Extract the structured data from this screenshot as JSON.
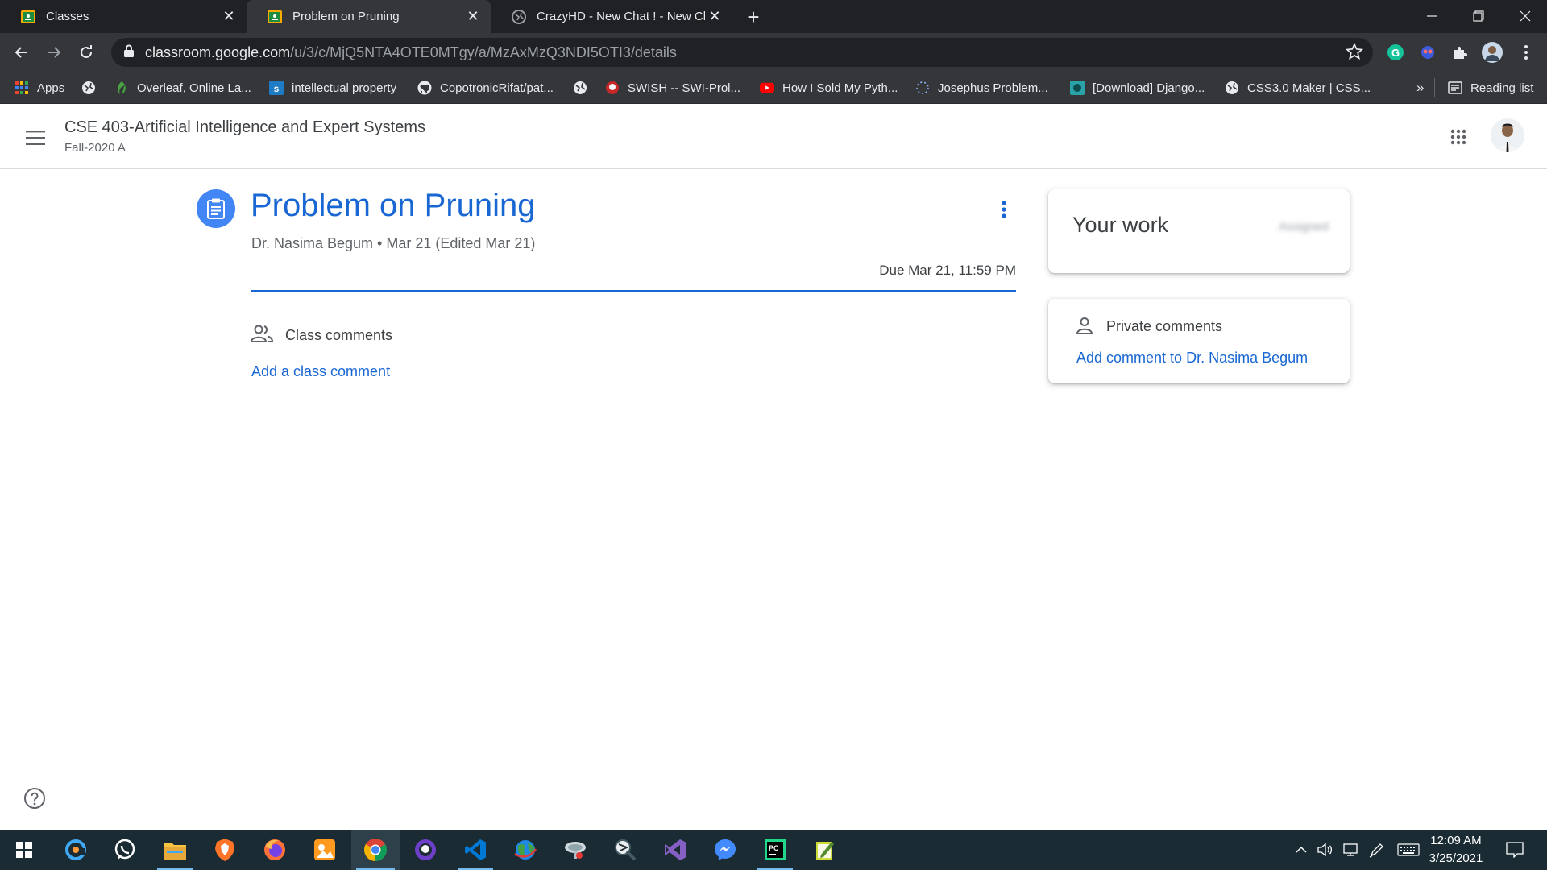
{
  "browser": {
    "tabs": [
      {
        "label": "Classes",
        "icon": "classroom-icon",
        "active": false
      },
      {
        "label": "Problem on Pruning",
        "icon": "classroom-icon",
        "active": true
      },
      {
        "label": "CrazyHD - New Chat ! - New Cha",
        "icon": "globe-icon",
        "active": false
      }
    ],
    "url_host": "classroom.google.com",
    "url_path": "/u/3/c/MjQ5NTA4OTE0MTgy/a/MzAxMzQ3NDI5OTI3/details",
    "bookmarks": [
      {
        "label": "Apps",
        "icon": "apps-grid-icon"
      },
      {
        "label": "",
        "icon": "globe-icon"
      },
      {
        "label": "Overleaf, Online La...",
        "icon": "overleaf-icon"
      },
      {
        "label": "intellectual property",
        "icon": "scribd-icon"
      },
      {
        "label": "CopotronicRifat/pat...",
        "icon": "github-icon"
      },
      {
        "label": "",
        "icon": "globe-icon"
      },
      {
        "label": "SWISH -- SWI-Prol...",
        "icon": "swish-icon"
      },
      {
        "label": "How I Sold My Pyth...",
        "icon": "youtube-icon"
      },
      {
        "label": "Josephus Problem...",
        "icon": "loading-icon"
      },
      {
        "label": "[Download] Django...",
        "icon": "django-icon"
      },
      {
        "label": "CSS3.0 Maker | CSS...",
        "icon": "globe-icon"
      }
    ],
    "more_bookmarks": "»",
    "reading_list": "Reading list"
  },
  "classroom": {
    "course_title": "CSE 403-Artificial Intelligence and Expert Systems",
    "course_section": "Fall-2020 A",
    "assignment": {
      "title": "Problem on Pruning",
      "meta": "Dr. Nasima Begum • Mar 21 (Edited Mar 21)",
      "due": "Due Mar 21, 11:59 PM"
    },
    "class_comments_label": "Class comments",
    "add_class_comment": "Add a class comment",
    "your_work": {
      "title": "Your work",
      "status": "Assigned"
    },
    "private_comments_label": "Private comments",
    "add_private_comment": "Add comment to Dr. Nasima Begum"
  },
  "taskbar": {
    "apps": [
      "start-icon",
      "qbittorrent-icon",
      "whatsapp-icon",
      "file-explorer-icon",
      "brave-icon",
      "firefox-icon",
      "photo-app-icon",
      "chrome-icon",
      "github-desktop-icon",
      "vscode-icon",
      "earth-icon",
      "satellite-icon",
      "tool-icon",
      "visual-studio-icon",
      "messenger-icon",
      "pycharm-icon",
      "notepad-icon"
    ],
    "time": "12:09 AM",
    "date": "3/25/2021"
  },
  "colors": {
    "accent_blue": "#1967d2",
    "icon_blue": "#4285f4",
    "chrome_dark": "#202124",
    "chrome_toolbar": "#35363a",
    "taskbar": "#1a2b33"
  }
}
